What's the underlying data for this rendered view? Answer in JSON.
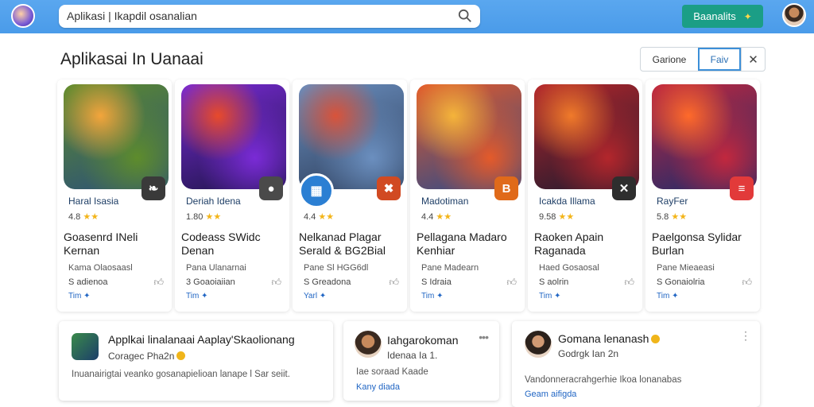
{
  "topbar": {
    "search_text": "Aplikasi | Ikapdil osanalian",
    "button_label": "Baanalits"
  },
  "header": {
    "title": "Aplikasai In Uanaai",
    "filters": [
      "Garione",
      "Faiv"
    ],
    "active_filter": "Faiv"
  },
  "apps": [
    {
      "name": "Haral Isasia",
      "rating": "4.8",
      "title": "Goasenrd INeli Kernan",
      "sub": "Kama Olaosaasl",
      "meta": "S adienoa",
      "link": "Tim",
      "colors": [
        "#f3a53b",
        "#5e8c2c",
        "#2a4f7a"
      ],
      "badge_color": "#3a3a3a",
      "badge_icon": "leaf-icon"
    },
    {
      "name": "Deriah Idena",
      "rating": "1.80",
      "title": "Codeass SWidc Denan",
      "sub": "Pana Ulanarnai",
      "meta": "3 Goaoiaiian",
      "link": "Tim",
      "colors": [
        "#e84a2b",
        "#7a2bd6",
        "#1b1445"
      ],
      "badge_color": "#4a4a4a",
      "badge_icon": "chat-icon"
    },
    {
      "name": "",
      "rating": "4.4",
      "title": "Nelkanad Plagar Serald & BG2Bial",
      "sub": "Pane Sl HGG6dl",
      "meta": "S Greadona",
      "link": "Yarl",
      "colors": [
        "#d9533a",
        "#6b8fbf",
        "#2c3d5a"
      ],
      "badge_color": "#d14a22",
      "badge_icon": "grid-icon"
    },
    {
      "name": "Madotiman",
      "rating": "4.4",
      "title": "Pellagana Madaro Kenhiar",
      "sub": "Pane Madearn",
      "meta": "S Idraia",
      "link": "Tim",
      "colors": [
        "#f5b43a",
        "#e45a2a",
        "#2b4a8a"
      ],
      "badge_color": "#e06a1a",
      "badge_icon": "bookmark-icon"
    },
    {
      "name": "Icakda Illama",
      "rating": "9.58",
      "title": "Raoken Apain Raganada",
      "sub": "Haed Gosaosal",
      "meta": "S aolrin",
      "link": "Tim",
      "colors": [
        "#f07a2a",
        "#b3262c",
        "#1e1a2e"
      ],
      "badge_color": "#2e2e2e",
      "badge_icon": "cross-icon"
    },
    {
      "name": "RayFer",
      "rating": "5.8",
      "title": "Paelgonsa Sylidar Burlan",
      "sub": "Pane Mieaeasi",
      "meta": "S Gonaiolria",
      "link": "Tim",
      "colors": [
        "#ff6a2a",
        "#c2283e",
        "#1b2a6b"
      ],
      "badge_color": "#e23a3a",
      "badge_icon": "flag-icon"
    }
  ],
  "reviews": [
    {
      "title": "Applkai linalanaai Aaplay'Skaolionang",
      "sub": "Coragec Pha2n",
      "body": "Inuanairigtai veanko gosanapielioan lanape l Sar seiit.",
      "link": ""
    },
    {
      "title": "Iahgarokoman",
      "sub": "Idenaa Ia 1.",
      "body": "Iae soraad Kaade",
      "link": "Kany diada"
    },
    {
      "title": "Gomana lenanash",
      "sub": "Godrgk Ian 2n",
      "body": "Vandonneracrahgerhie Ikoa lonanabas",
      "link": "Geam aifigda"
    }
  ]
}
